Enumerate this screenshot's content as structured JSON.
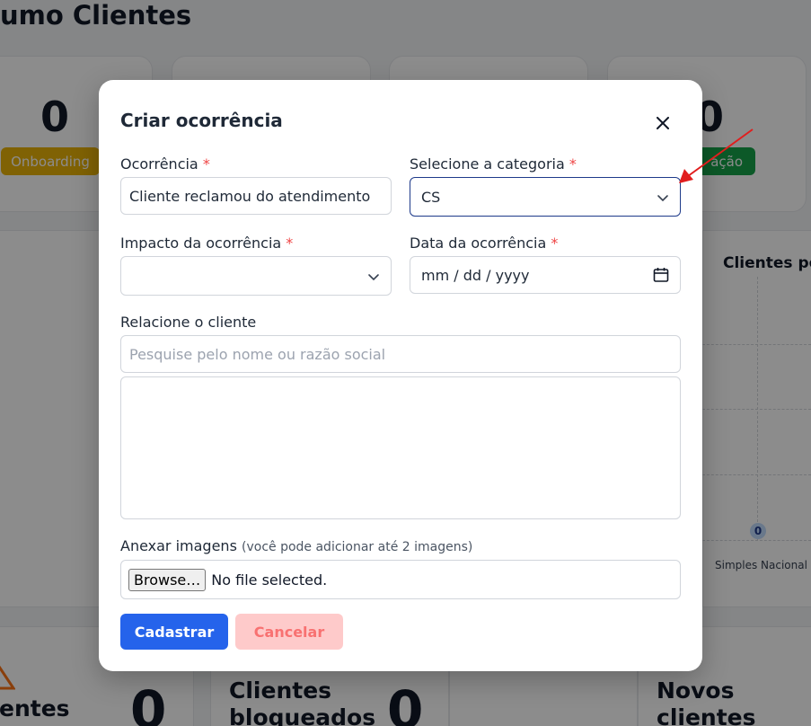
{
  "background": {
    "page_title": "umo Clientes",
    "stat_cards": [
      {
        "value": "0",
        "badge": "Onboarding",
        "badge_color": "#eab308"
      },
      {
        "value": "0",
        "badge": "ação",
        "badge_color": "#16a34a"
      }
    ],
    "chart": {
      "title": "Clientes po",
      "point_label": "0",
      "x_tick": "Simples Nacional"
    },
    "bottom_cards": [
      {
        "label": "entes",
        "value": "0"
      },
      {
        "label": "Clientes bloqueados",
        "value": "0"
      },
      {
        "label": "Novos clientes",
        "value": ""
      }
    ]
  },
  "modal": {
    "title": "Criar ocorrência",
    "fields": {
      "ocorrencia": {
        "label": "Ocorrência",
        "required": "*",
        "value": "Cliente reclamou do atendimento"
      },
      "categoria": {
        "label": "Selecione a categoria",
        "required": "*",
        "value": "CS"
      },
      "impacto": {
        "label": "Impacto da ocorrência",
        "required": "*",
        "value": ""
      },
      "data": {
        "label": "Data da ocorrência",
        "required": "*",
        "value": "mm / dd / yyyy"
      },
      "cliente": {
        "label": "Relacione o cliente",
        "placeholder": "Pesquise pelo nome ou razão social"
      }
    },
    "attachments": {
      "label": "Anexar imagens",
      "hint": "(você pode adicionar até 2 imagens)",
      "browse_label": "Browse…",
      "status": "No file selected."
    },
    "buttons": {
      "submit": "Cadastrar",
      "cancel": "Cancelar"
    }
  },
  "colors": {
    "primary": "#2563eb",
    "danger_light": "#fecaca",
    "required": "#ef4444",
    "arrow": "#e11d1d"
  }
}
